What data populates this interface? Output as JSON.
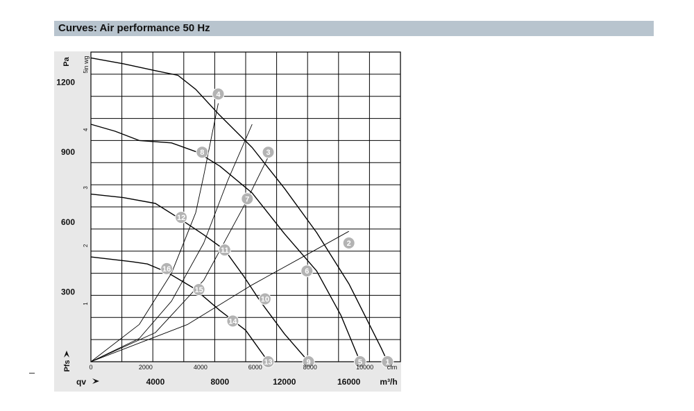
{
  "title": "Curves: Air performance 50 Hz",
  "chart_data": {
    "type": "line",
    "title": "Curves: Air performance 50 Hz",
    "y_axis_primary": {
      "unit": "Pa",
      "ticks": [
        "300",
        "600",
        "900",
        "1200"
      ],
      "ylim": [
        0,
        1330
      ]
    },
    "y_axis_secondary": {
      "unit": "in wg",
      "ticks": [
        "1",
        "2",
        "3",
        "4",
        "5"
      ]
    },
    "y_label": "Pfs",
    "x_axis_primary": {
      "unit": "m³/h",
      "label": "qv",
      "ticks": [
        "4000",
        "8000",
        "12000",
        "16000"
      ],
      "xlim": [
        0,
        19200
      ]
    },
    "x_axis_secondary": {
      "unit": "cfm",
      "ticks": [
        "0",
        "2000",
        "4000",
        "6000",
        "8000",
        "10000"
      ]
    },
    "grid": true,
    "fan_curves": [
      {
        "name": "1-4",
        "points": [
          [
            0,
            1305
          ],
          [
            2000,
            1280
          ],
          [
            4000,
            1250
          ],
          [
            5400,
            1230
          ],
          [
            6500,
            1170
          ],
          [
            7900,
            1065
          ],
          [
            10000,
            920
          ],
          [
            12000,
            745
          ],
          [
            14000,
            555
          ],
          [
            16000,
            335
          ],
          [
            18000,
            60
          ],
          [
            18400,
            0
          ]
        ]
      },
      {
        "name": "5-8",
        "points": [
          [
            0,
            1020
          ],
          [
            1500,
            990
          ],
          [
            3000,
            950
          ],
          [
            5000,
            940
          ],
          [
            6600,
            900
          ],
          [
            8000,
            840
          ],
          [
            10000,
            725
          ],
          [
            12000,
            550
          ],
          [
            14000,
            390
          ],
          [
            15500,
            200
          ],
          [
            16700,
            0
          ]
        ]
      },
      {
        "name": "9-12",
        "points": [
          [
            0,
            720
          ],
          [
            2000,
            705
          ],
          [
            4000,
            680
          ],
          [
            5600,
            610
          ],
          [
            7000,
            545
          ],
          [
            8300,
            480
          ],
          [
            9500,
            365
          ],
          [
            10500,
            260
          ],
          [
            12000,
            120
          ],
          [
            13500,
            0
          ]
        ]
      },
      {
        "name": "13-16",
        "points": [
          [
            0,
            450
          ],
          [
            2500,
            430
          ],
          [
            3500,
            420
          ],
          [
            4700,
            385
          ],
          [
            6400,
            315
          ],
          [
            8000,
            220
          ],
          [
            9600,
            135
          ],
          [
            11000,
            0
          ]
        ]
      }
    ],
    "system_curves": [
      {
        "name": "",
        "points": [
          [
            0,
            0
          ],
          [
            3000,
            160
          ],
          [
            5000,
            380
          ],
          [
            6500,
            640
          ],
          [
            7000,
            800
          ],
          [
            7900,
            1110
          ]
        ]
      },
      {
        "name": "",
        "points": [
          [
            0,
            0
          ],
          [
            3000,
            100
          ],
          [
            5000,
            260
          ],
          [
            7000,
            510
          ],
          [
            8500,
            780
          ],
          [
            10000,
            1020
          ]
        ]
      },
      {
        "name": "",
        "points": [
          [
            0,
            0
          ],
          [
            4000,
            125
          ],
          [
            7000,
            350
          ],
          [
            9500,
            670
          ],
          [
            11000,
            880
          ]
        ]
      },
      {
        "name": "",
        "points": [
          [
            0,
            0
          ],
          [
            6000,
            160
          ],
          [
            10000,
            330
          ],
          [
            13400,
            460
          ],
          [
            16000,
            560
          ]
        ]
      }
    ],
    "markers": [
      {
        "label": "1",
        "x": 18400,
        "y": 0
      },
      {
        "label": "2",
        "x": 16000,
        "y": 510
      },
      {
        "label": "3",
        "x": 11000,
        "y": 900
      },
      {
        "label": "4",
        "x": 7900,
        "y": 1150
      },
      {
        "label": "5",
        "x": 16700,
        "y": 0
      },
      {
        "label": "6",
        "x": 13400,
        "y": 390
      },
      {
        "label": "7",
        "x": 9700,
        "y": 700
      },
      {
        "label": "8",
        "x": 6900,
        "y": 900
      },
      {
        "label": "9",
        "x": 13500,
        "y": 0
      },
      {
        "label": "10",
        "x": 10800,
        "y": 270
      },
      {
        "label": "11",
        "x": 8300,
        "y": 480
      },
      {
        "label": "12",
        "x": 5600,
        "y": 620
      },
      {
        "label": "13",
        "x": 11000,
        "y": 0
      },
      {
        "label": "14",
        "x": 8800,
        "y": 175
      },
      {
        "label": "15",
        "x": 6700,
        "y": 310
      },
      {
        "label": "16",
        "x": 4700,
        "y": 400
      }
    ]
  }
}
